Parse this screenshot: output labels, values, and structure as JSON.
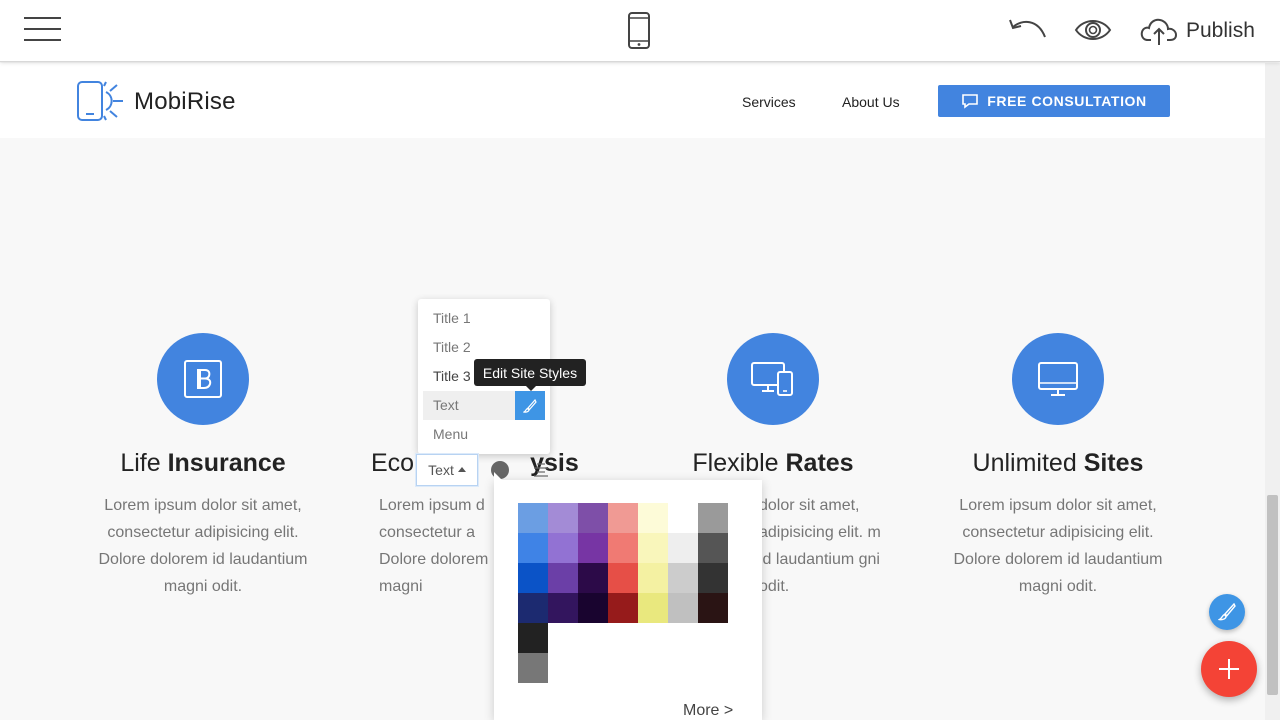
{
  "editor": {
    "menu_icon": "hamburger-icon",
    "device_icon": "mobile-phone-icon",
    "undo_icon": "undo-icon",
    "preview_icon": "eye-icon",
    "publish_icon": "cloud-upload-icon",
    "publish_label": "Publish"
  },
  "site": {
    "brand": "MobiRise",
    "nav": [
      "Services",
      "About Us"
    ],
    "cta_label": "FREE CONSULTATION",
    "accent_color": "#4284df"
  },
  "features": [
    {
      "icon": "bootstrap-icon",
      "title_light": "Life ",
      "title_bold": "Insurance",
      "text": "Lorem ipsum dolor sit amet, consectetur adipisicing elit. Dolore dolorem id laudantium magni odit."
    },
    {
      "icon": "",
      "title_light": "Eco",
      "title_bold": "ysis",
      "text": "Lorem ipsum d consectetur a Dolore dolorem magni"
    },
    {
      "icon": "responsive-devices-icon",
      "title_light": "Flexible ",
      "title_bold": "Rates",
      "text": "dolor sit amet, adipisicing elit. m id laudantium gni odit."
    },
    {
      "icon": "desktop-monitor-icon",
      "title_light": "Unlimited ",
      "title_bold": "Sites",
      "text": "Lorem ipsum dolor sit amet, consectetur adipisicing elit. Dolore dolorem id laudantium magni odit."
    }
  ],
  "style_menu": {
    "items": [
      "Title 1",
      "Title 2",
      "Title 3",
      "Text",
      "Menu"
    ],
    "selected": "Text",
    "tooltip": "Edit Site Styles"
  },
  "text_toolbar": {
    "dropdown_label": "Text",
    "current_color": "#666666"
  },
  "palette": {
    "rows": [
      [
        "#6b9ee3",
        "#a38bd6",
        "#7e4fa8",
        "#f09a94",
        "#fdfbd8",
        "#ffffff",
        "#9a9a9a"
      ],
      [
        "#3f83e6",
        "#9272d3",
        "#7735a4",
        "#f07a73",
        "#f9f6bb",
        "#eeeeee",
        "#555555"
      ],
      [
        "#0b53c7",
        "#6b3fa7",
        "#2c0a48",
        "#e64f47",
        "#f4f1a2",
        "#cccccc",
        "#333333"
      ],
      [
        "#1c2a70",
        "#33155e",
        "#19042f",
        "#961b1b",
        "#e9e87e",
        "#c0c0c0",
        "#2a1414"
      ],
      [
        "#222222"
      ],
      [
        "#777777"
      ]
    ],
    "more_label": "More >"
  },
  "fab": {
    "style_icon": "brush-icon",
    "add_icon": "plus-icon",
    "add_color": "#f44336"
  }
}
